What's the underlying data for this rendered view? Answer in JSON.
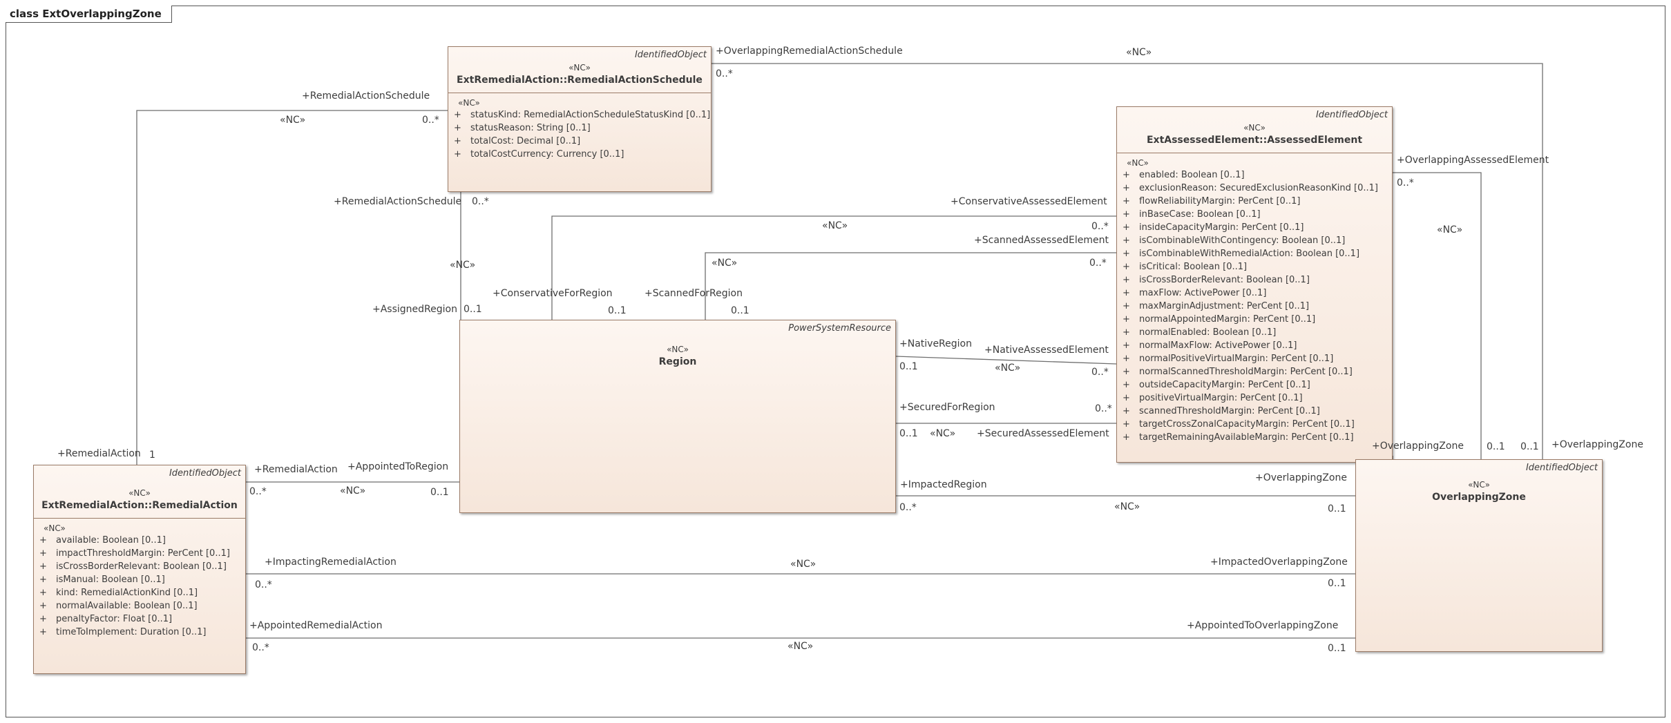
{
  "diagram_title": "class ExtOverlappingZone",
  "classes": {
    "schedule": {
      "tag": "IdentifiedObject",
      "stereotype": "«NC»",
      "name": "ExtRemedialAction::RemedialActionSchedule",
      "attr_stereotype": "«NC»",
      "attributes": [
        "statusKind: RemedialActionScheduleStatusKind [0..1]",
        "statusReason: String [0..1]",
        "totalCost: Decimal [0..1]",
        "totalCostCurrency: Currency [0..1]"
      ]
    },
    "assessed": {
      "tag": "IdentifiedObject",
      "stereotype": "«NC»",
      "name": "ExtAssessedElement::AssessedElement",
      "attr_stereotype": "«NC»",
      "attributes": [
        "enabled: Boolean [0..1]",
        "exclusionReason: SecuredExclusionReasonKind [0..1]",
        "flowReliabilityMargin: PerCent [0..1]",
        "inBaseCase: Boolean [0..1]",
        "insideCapacityMargin: PerCent [0..1]",
        "isCombinableWithContingency: Boolean [0..1]",
        "isCombinableWithRemedialAction: Boolean [0..1]",
        "isCritical: Boolean [0..1]",
        "isCrossBorderRelevant: Boolean [0..1]",
        "maxFlow: ActivePower [0..1]",
        "maxMarginAdjustment: PerCent [0..1]",
        "normalAppointedMargin: PerCent [0..1]",
        "normalEnabled: Boolean [0..1]",
        "normalMaxFlow: ActivePower [0..1]",
        "normalPositiveVirtualMargin: PerCent [0..1]",
        "normalScannedThresholdMargin: PerCent [0..1]",
        "outsideCapacityMargin: PerCent [0..1]",
        "positiveVirtualMargin: PerCent [0..1]",
        "scannedThresholdMargin: PerCent [0..1]",
        "targetCrossZonalCapacityMargin: PerCent [0..1]",
        "targetRemainingAvailableMargin: PerCent [0..1]"
      ]
    },
    "region": {
      "tag": "PowerSystemResource",
      "stereotype": "«NC»",
      "name": "Region"
    },
    "action": {
      "tag": "IdentifiedObject",
      "stereotype": "«NC»",
      "name": "ExtRemedialAction::RemedialAction",
      "attr_stereotype": "«NC»",
      "attributes": [
        "available: Boolean [0..1]",
        "impactThresholdMargin: PerCent [0..1]",
        "isCrossBorderRelevant: Boolean [0..1]",
        "isManual: Boolean [0..1]",
        "kind: RemedialActionKind [0..1]",
        "normalAvailable: Boolean [0..1]",
        "penaltyFactor: Float [0..1]",
        "timeToImplement: Duration [0..1]"
      ]
    },
    "zone": {
      "tag": "IdentifiedObject",
      "stereotype": "«NC»",
      "name": "OverlappingZone"
    }
  },
  "attr_marker": "+",
  "labels": {
    "l01": "+OverlappingRemedialActionSchedule",
    "l02": "0..*",
    "l03": "«NC»",
    "l04": "+RemedialActionSchedule",
    "l05": "«NC»",
    "l06": "0..*",
    "l07": "+RemedialActionSchedule",
    "l08": "0..*",
    "l09": "«NC»",
    "l10": "+AssignedRegion",
    "l11": "0..1",
    "l12": "+ConservativeAssessedElement",
    "l13": "«NC»",
    "l14": "0..*",
    "l15": "+ScannedAssessedElement",
    "l16": "«NC»",
    "l17": "0..*",
    "l18": "+ConservativeForRegion",
    "l19": "0..1",
    "l20": "+ScannedForRegion",
    "l21": "0..1",
    "l22": "+OverlappingAssessedElement",
    "l23": "0..*",
    "l24": "«NC»",
    "l25": "+NativeRegion",
    "l26": "+NativeAssessedElement",
    "l27": "0..1",
    "l28": "«NC»",
    "l29": "0..*",
    "l30": "+SecuredForRegion",
    "l31": "0..*",
    "l32": "0..1",
    "l33": "«NC»",
    "l34": "+SecuredAssessedElement",
    "l35": "+RemedialAction",
    "l36": "1",
    "l37": "+RemedialAction",
    "l38": "+AppointedToRegion",
    "l39": "0..*",
    "l40": "«NC»",
    "l41": "0..1",
    "l42": "+OverlappingZone",
    "l43": "0..1",
    "l44": "0..1",
    "l45": "+OverlappingZone",
    "l46": "+ImpactedRegion",
    "l47": "+OverlappingZone",
    "l48": "0..*",
    "l49": "«NC»",
    "l50": "0..1",
    "l51": "+ImpactingRemedialAction",
    "l52": "«NC»",
    "l53": "+ImpactedOverlappingZone",
    "l54": "0..*",
    "l55": "0..1",
    "l56": "+AppointedRemedialAction",
    "l57": "+AppointedToOverlappingZone",
    "l58": "0..*",
    "l59": "«NC»",
    "l60": "0..1"
  }
}
